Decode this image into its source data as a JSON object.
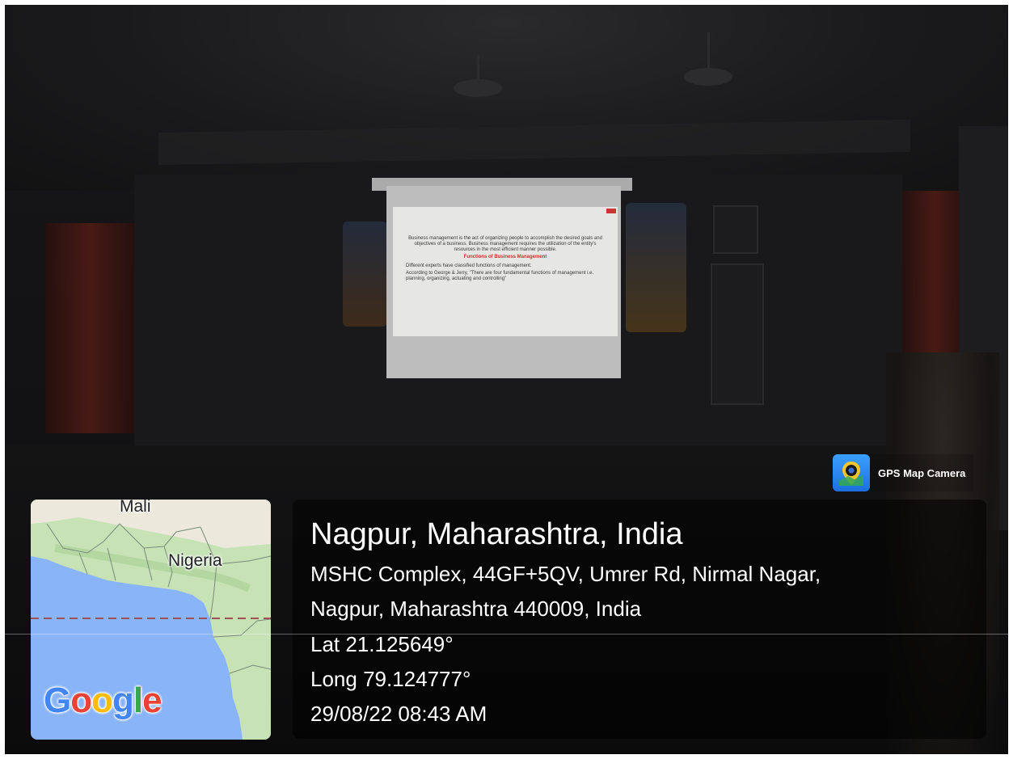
{
  "badge": {
    "app_name": "GPS Map Camera",
    "icon": "camera-lens-icon"
  },
  "location": {
    "title": "Nagpur, Maharashtra, India",
    "address_line1": "MSHC Complex, 44GF+5QV, Umrer Rd, Nirmal Nagar,",
    "address_line2": "Nagpur, Maharashtra 440009, India",
    "latitude": "Lat 21.125649°",
    "longitude": "Long 79.124777°",
    "datetime": "29/08/22 08:43 AM"
  },
  "map": {
    "labels": [
      "Mali",
      "Nigeria"
    ],
    "logo": "Google",
    "colors": {
      "water": "#8ab4f8",
      "land": "#c7e3b6",
      "equator": "#a05050"
    }
  },
  "slide": {
    "paragraph": "Business management is the act of organizing people to accomplish the desired goals and objectives of a business. Business management requires the utilization of the entity's resources in the most efficient manner possible.",
    "heading": "Functions of Business Management",
    "line1": "Different experts have classified functions of management.",
    "line2": "According to George & Jerry, \"There are four fundamental functions of management i.e. planning, organizing, actuating and controlling\""
  }
}
